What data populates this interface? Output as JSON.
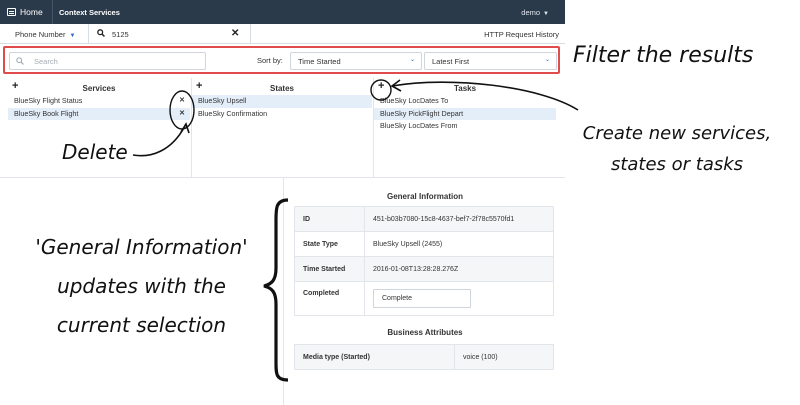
{
  "topbar": {
    "home_label": "Home",
    "module_label": "Context Services",
    "user_label": "demo"
  },
  "search": {
    "filter_type": "Phone Number",
    "query": "5125",
    "history_link": "HTTP Request History"
  },
  "filters": {
    "search_placeholder": "Search",
    "sort_label": "Sort by:",
    "sort_field": "Time Started",
    "sort_order": "Latest First"
  },
  "columns": {
    "services": {
      "title": "Services",
      "items": [
        "BlueSky Flight Status",
        "BlueSky Book Flight"
      ]
    },
    "states": {
      "title": "States",
      "items": [
        "BlueSky Upsell",
        "BlueSky Confirmation"
      ]
    },
    "tasks": {
      "title": "Tasks",
      "items": [
        "BlueSky LocDates To",
        "BlueSky PickFlight Depart",
        "BlueSky LocDates From"
      ]
    }
  },
  "general_info": {
    "title": "General Information",
    "rows": [
      {
        "key": "ID",
        "value": "451-b03b7080-15c8-4637-bef7-2f78c5570fd1"
      },
      {
        "key": "State Type",
        "value": "BlueSky Upsell (2455)"
      },
      {
        "key": "Time Started",
        "value": "2016-01-08T13:28:28.276Z"
      },
      {
        "key": "Completed",
        "value": "Complete"
      }
    ]
  },
  "business_attributes": {
    "title": "Business Attributes",
    "rows": [
      {
        "key": "Media type (Started)",
        "value": "voice (100)"
      }
    ]
  },
  "annotations": {
    "filter": "Filter the results",
    "create_line1": "Create new services,",
    "create_line2": "states or tasks",
    "delete": "Delete",
    "general_line1": "'General Information'",
    "general_line2": "updates with  the",
    "general_line3": "current selection"
  },
  "colors": {
    "topbar_bg": "#2b3a4a",
    "highlight_border": "#e04c4c",
    "selected_row_bg": "#e4eef9",
    "accent": "#2a66c7"
  }
}
